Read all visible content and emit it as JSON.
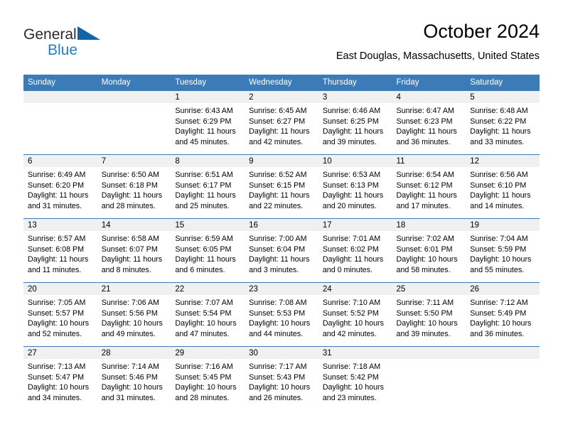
{
  "brand": {
    "name_part1": "General",
    "name_part2": "Blue",
    "triangle_icon": "triangle-icon",
    "color_dark": "#2b2b2b",
    "color_blue": "#1d7fd0"
  },
  "header": {
    "title": "October 2024",
    "subtitle": "East Douglas, Massachusetts, United States"
  },
  "theme": {
    "header_blue": "#3b7cb8",
    "daynum_band_gray": "#f0f0f0",
    "text": "#000000"
  },
  "weekday_headers": [
    "Sunday",
    "Monday",
    "Tuesday",
    "Wednesday",
    "Thursday",
    "Friday",
    "Saturday"
  ],
  "labels": {
    "sunrise_prefix": "Sunrise:",
    "sunset_prefix": "Sunset:",
    "daylight_prefix": "Daylight:"
  },
  "weeks": [
    [
      {
        "day": "",
        "blank": true,
        "sunrise": "",
        "sunset": "",
        "daylight": ""
      },
      {
        "day": "",
        "blank": true,
        "sunrise": "",
        "sunset": "",
        "daylight": ""
      },
      {
        "day": "1",
        "sunrise": "Sunrise: 6:43 AM",
        "sunset": "Sunset: 6:29 PM",
        "daylight": "Daylight: 11 hours and 45 minutes."
      },
      {
        "day": "2",
        "sunrise": "Sunrise: 6:45 AM",
        "sunset": "Sunset: 6:27 PM",
        "daylight": "Daylight: 11 hours and 42 minutes."
      },
      {
        "day": "3",
        "sunrise": "Sunrise: 6:46 AM",
        "sunset": "Sunset: 6:25 PM",
        "daylight": "Daylight: 11 hours and 39 minutes."
      },
      {
        "day": "4",
        "sunrise": "Sunrise: 6:47 AM",
        "sunset": "Sunset: 6:23 PM",
        "daylight": "Daylight: 11 hours and 36 minutes."
      },
      {
        "day": "5",
        "sunrise": "Sunrise: 6:48 AM",
        "sunset": "Sunset: 6:22 PM",
        "daylight": "Daylight: 11 hours and 33 minutes."
      }
    ],
    [
      {
        "day": "6",
        "sunrise": "Sunrise: 6:49 AM",
        "sunset": "Sunset: 6:20 PM",
        "daylight": "Daylight: 11 hours and 31 minutes."
      },
      {
        "day": "7",
        "sunrise": "Sunrise: 6:50 AM",
        "sunset": "Sunset: 6:18 PM",
        "daylight": "Daylight: 11 hours and 28 minutes."
      },
      {
        "day": "8",
        "sunrise": "Sunrise: 6:51 AM",
        "sunset": "Sunset: 6:17 PM",
        "daylight": "Daylight: 11 hours and 25 minutes."
      },
      {
        "day": "9",
        "sunrise": "Sunrise: 6:52 AM",
        "sunset": "Sunset: 6:15 PM",
        "daylight": "Daylight: 11 hours and 22 minutes."
      },
      {
        "day": "10",
        "sunrise": "Sunrise: 6:53 AM",
        "sunset": "Sunset: 6:13 PM",
        "daylight": "Daylight: 11 hours and 20 minutes."
      },
      {
        "day": "11",
        "sunrise": "Sunrise: 6:54 AM",
        "sunset": "Sunset: 6:12 PM",
        "daylight": "Daylight: 11 hours and 17 minutes."
      },
      {
        "day": "12",
        "sunrise": "Sunrise: 6:56 AM",
        "sunset": "Sunset: 6:10 PM",
        "daylight": "Daylight: 11 hours and 14 minutes."
      }
    ],
    [
      {
        "day": "13",
        "sunrise": "Sunrise: 6:57 AM",
        "sunset": "Sunset: 6:08 PM",
        "daylight": "Daylight: 11 hours and 11 minutes."
      },
      {
        "day": "14",
        "sunrise": "Sunrise: 6:58 AM",
        "sunset": "Sunset: 6:07 PM",
        "daylight": "Daylight: 11 hours and 8 minutes."
      },
      {
        "day": "15",
        "sunrise": "Sunrise: 6:59 AM",
        "sunset": "Sunset: 6:05 PM",
        "daylight": "Daylight: 11 hours and 6 minutes."
      },
      {
        "day": "16",
        "sunrise": "Sunrise: 7:00 AM",
        "sunset": "Sunset: 6:04 PM",
        "daylight": "Daylight: 11 hours and 3 minutes."
      },
      {
        "day": "17",
        "sunrise": "Sunrise: 7:01 AM",
        "sunset": "Sunset: 6:02 PM",
        "daylight": "Daylight: 11 hours and 0 minutes."
      },
      {
        "day": "18",
        "sunrise": "Sunrise: 7:02 AM",
        "sunset": "Sunset: 6:01 PM",
        "daylight": "Daylight: 10 hours and 58 minutes."
      },
      {
        "day": "19",
        "sunrise": "Sunrise: 7:04 AM",
        "sunset": "Sunset: 5:59 PM",
        "daylight": "Daylight: 10 hours and 55 minutes."
      }
    ],
    [
      {
        "day": "20",
        "sunrise": "Sunrise: 7:05 AM",
        "sunset": "Sunset: 5:57 PM",
        "daylight": "Daylight: 10 hours and 52 minutes."
      },
      {
        "day": "21",
        "sunrise": "Sunrise: 7:06 AM",
        "sunset": "Sunset: 5:56 PM",
        "daylight": "Daylight: 10 hours and 49 minutes."
      },
      {
        "day": "22",
        "sunrise": "Sunrise: 7:07 AM",
        "sunset": "Sunset: 5:54 PM",
        "daylight": "Daylight: 10 hours and 47 minutes."
      },
      {
        "day": "23",
        "sunrise": "Sunrise: 7:08 AM",
        "sunset": "Sunset: 5:53 PM",
        "daylight": "Daylight: 10 hours and 44 minutes."
      },
      {
        "day": "24",
        "sunrise": "Sunrise: 7:10 AM",
        "sunset": "Sunset: 5:52 PM",
        "daylight": "Daylight: 10 hours and 42 minutes."
      },
      {
        "day": "25",
        "sunrise": "Sunrise: 7:11 AM",
        "sunset": "Sunset: 5:50 PM",
        "daylight": "Daylight: 10 hours and 39 minutes."
      },
      {
        "day": "26",
        "sunrise": "Sunrise: 7:12 AM",
        "sunset": "Sunset: 5:49 PM",
        "daylight": "Daylight: 10 hours and 36 minutes."
      }
    ],
    [
      {
        "day": "27",
        "sunrise": "Sunrise: 7:13 AM",
        "sunset": "Sunset: 5:47 PM",
        "daylight": "Daylight: 10 hours and 34 minutes."
      },
      {
        "day": "28",
        "sunrise": "Sunrise: 7:14 AM",
        "sunset": "Sunset: 5:46 PM",
        "daylight": "Daylight: 10 hours and 31 minutes."
      },
      {
        "day": "29",
        "sunrise": "Sunrise: 7:16 AM",
        "sunset": "Sunset: 5:45 PM",
        "daylight": "Daylight: 10 hours and 28 minutes."
      },
      {
        "day": "30",
        "sunrise": "Sunrise: 7:17 AM",
        "sunset": "Sunset: 5:43 PM",
        "daylight": "Daylight: 10 hours and 26 minutes."
      },
      {
        "day": "31",
        "sunrise": "Sunrise: 7:18 AM",
        "sunset": "Sunset: 5:42 PM",
        "daylight": "Daylight: 10 hours and 23 minutes."
      },
      {
        "day": "",
        "blank": true,
        "sunrise": "",
        "sunset": "",
        "daylight": ""
      },
      {
        "day": "",
        "blank": true,
        "sunrise": "",
        "sunset": "",
        "daylight": ""
      }
    ]
  ]
}
